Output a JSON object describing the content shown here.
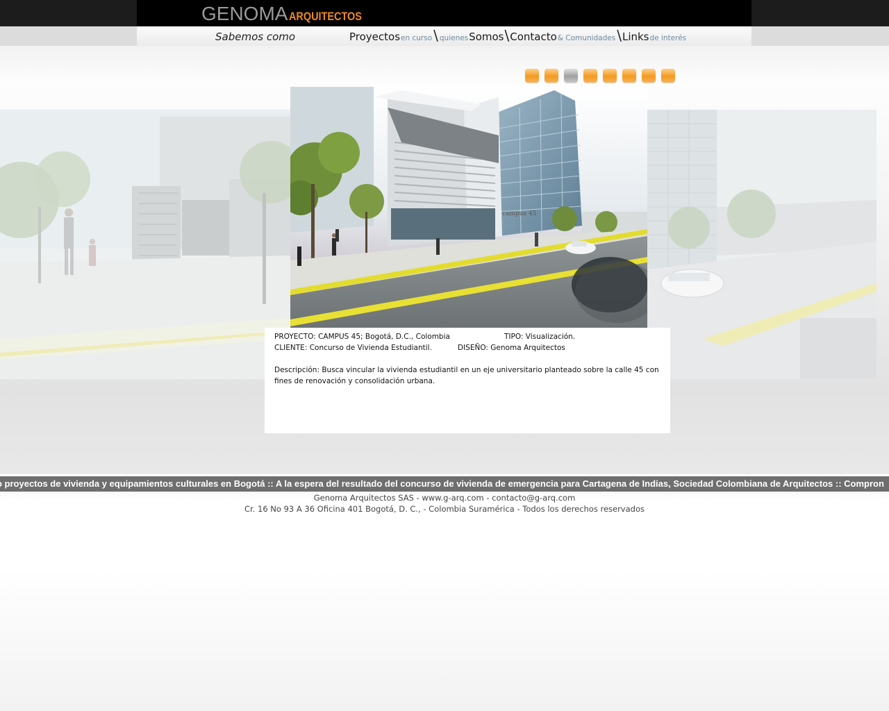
{
  "header": {
    "logo_main": "GENOMA",
    "logo_sub": "ARQUITECTOS"
  },
  "nav": {
    "tagline": "Sabemos como",
    "proyectos": "Proyectos",
    "proyectos_sub": "en curso",
    "quienes": "quienes",
    "somos": "Somos",
    "contacto": "Contacto",
    "contacto_sub": "& Comunidades",
    "links": "Links",
    "links_sub": "de interés"
  },
  "gallery": {
    "thumbnail_count": 8,
    "active_index": 2,
    "building_sign": "campus 45"
  },
  "project": {
    "proyecto": "PROYECTO: CAMPUS 45; Bogotá, D.C., Colombia",
    "tipo": "TIPO: Visualización.",
    "cliente": "CLIENTE: Concurso de Vivienda Estudiantil.",
    "diseno": "DISEÑO: Genoma Arquitectos",
    "descripcion_1": "Descripción: Busca vincular la vivienda estudiantil en un eje universitario planteado sobre la calle 45 con",
    "descripcion_2": "fines de renovación y consolidación urbana."
  },
  "ticker": {
    "text": "o proyectos de vivienda y equipamientos culturales en Bogotá :: A la espera del resultado del concurso de vivienda de emergencia para Cartagena de Indias, Sociedad Colombiana de Arquitectos :: Compron"
  },
  "footer": {
    "line1": "Genoma Arquitectos SAS - www.g-arq.com - contacto@g-arq.com",
    "line2": "Cr. 16 No 93 A 36 Oficina 401 Bogotá, D. C., - Colombia Suramérica - Todos los derechos reservados"
  },
  "colors": {
    "accent_orange": "#f08a1e",
    "nav_sub_blue": "#6d8a9e",
    "ticker_bg": "#6e6e6e"
  }
}
